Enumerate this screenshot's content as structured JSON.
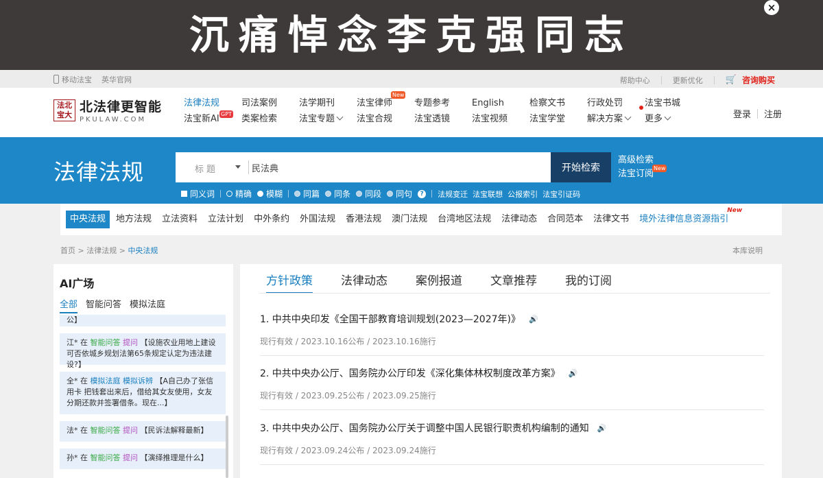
{
  "banner": {
    "text": "沉痛悼念李克强同志",
    "close": "×"
  },
  "util": {
    "mobile": "移动法宝",
    "yinghua": "英华官网",
    "help": "帮助中心",
    "update": "更新优化",
    "buy": "咨询购买"
  },
  "logo": {
    "seal": "法北宝大",
    "name_cn": "北法律更智能",
    "name_en": "PKULAW.COM"
  },
  "nav": {
    "row1": [
      "法律法规",
      "司法案例",
      "法学期刊",
      "法宝律师",
      "专题参考",
      "English",
      "检察文书",
      "行政处罚",
      "法宝书城"
    ],
    "row2": [
      "法宝新AI",
      "类案检索",
      "法宝专题",
      "法宝合规",
      "法宝透镜",
      "法宝视频",
      "法宝学堂",
      "解决方案",
      "更多"
    ],
    "tag_gpt": "GPT",
    "tag_new": "New"
  },
  "auth": {
    "login": "登录",
    "register": "注册"
  },
  "search": {
    "title": "法律法规",
    "field": "标题",
    "query": "民法典",
    "button": "开始检索",
    "advanced": "高级检索",
    "subscribe": "法宝订阅",
    "new_tag": "New",
    "synonym": "同义词",
    "exact": "精确",
    "fuzzy": "模糊",
    "scopes": [
      "同篇",
      "同条",
      "同段",
      "同句"
    ],
    "help": "?",
    "links": [
      "法规变迁",
      "法宝联想",
      "公报索引",
      "法宝引证码"
    ]
  },
  "categories": {
    "items": [
      "中央法规",
      "地方法规",
      "立法资料",
      "立法计划",
      "中外条约",
      "外国法规",
      "香港法规",
      "澳门法规",
      "台湾地区法规",
      "法律动态",
      "合同范本",
      "法律文书"
    ],
    "foreign": "境外法律信息资源指引",
    "foreign_tag": "New"
  },
  "breadcrumb": {
    "home": "首页",
    "sep": " > ",
    "level1": "法律法规",
    "current": "中央法规",
    "lib_note": "本库说明"
  },
  "ai": {
    "title": "AI广场",
    "tabs": [
      "全部",
      "智能问答",
      "模拟法庭"
    ],
    "cut_top": "公】",
    "cards": [
      {
        "user": "江*",
        "zai": " 在 ",
        "mod": "智能问答",
        "act": "提问",
        "text": "【设施农业用地上建设可否依城乡规划法第65条规定认定为违法建设?】"
      },
      {
        "user": "全*",
        "zai": " 在 ",
        "mod": "模拟法庭",
        "act": "模拟诉辨",
        "text": "【A自己办了张信用卡 把钱套出来后，借给其女友使用，女友分期还款并签署借条。现在...】"
      },
      {
        "user": "法*",
        "zai": " 在 ",
        "mod": "智能问答",
        "act": "提问",
        "text": "【民诉法解释最新】"
      },
      {
        "user": "孙*",
        "zai": " 在 ",
        "mod": "智能问答",
        "act": "提问",
        "text": "【演绎推理是什么】"
      }
    ]
  },
  "main": {
    "tabs": [
      "方针政策",
      "法律动态",
      "案例报道",
      "文章推荐",
      "我的订阅"
    ],
    "items": [
      {
        "title": "1. 中共中央印发《全国干部教育培训规划(2023—2027年)》",
        "meta": "现行有效 / 2023.10.16公布 / 2023.10.16施行"
      },
      {
        "title": "2. 中共中央办公厅、国务院办公厅印发《深化集体林权制度改革方案》",
        "meta": "现行有效 / 2023.09.25公布 / 2023.09.25施行"
      },
      {
        "title": "3. 中共中央办公厅、国务院办公厅关于调整中国人民银行职责机构编制的通知",
        "meta": "现行有效 / 2023.09.24公布 / 2023.09.24施行"
      }
    ]
  },
  "colors": {
    "brand_blue": "#1e87c7",
    "banner_bg": "#3e3a39",
    "search_btn": "#183f66",
    "accent_red": "#e0231b"
  }
}
